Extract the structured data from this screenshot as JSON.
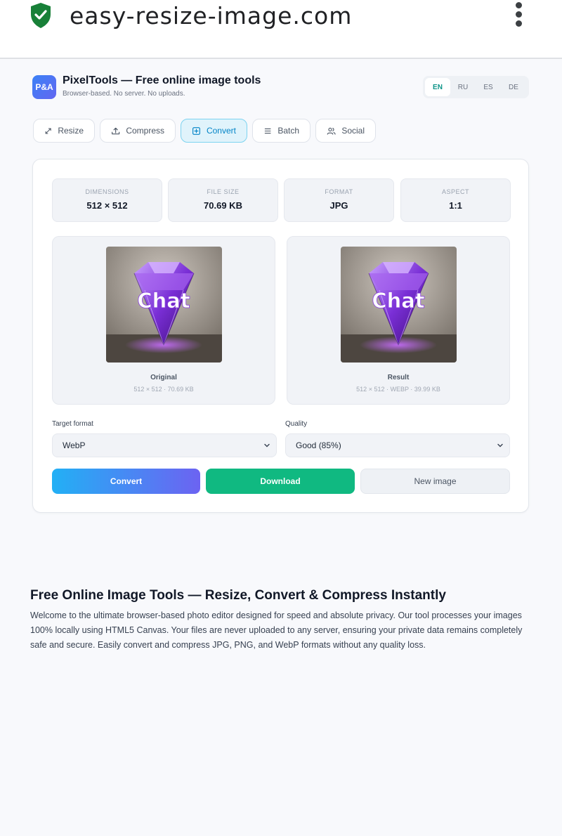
{
  "browser": {
    "url": "easy-resize-image.com",
    "secure_icon": "shield-check-icon",
    "menu_icon": "more-vert-icon"
  },
  "header": {
    "logo_text": "P&A",
    "title": "PixelTools — Free online image tools",
    "subtitle": "Browser-based. No server. No uploads.",
    "languages": [
      "EN",
      "RU",
      "ES",
      "DE"
    ],
    "active_language": "EN"
  },
  "tabs": [
    {
      "label": "Resize",
      "icon": "resize-icon"
    },
    {
      "label": "Compress",
      "icon": "upload-icon"
    },
    {
      "label": "Convert",
      "icon": "convert-icon",
      "active": true
    },
    {
      "label": "Batch",
      "icon": "list-icon"
    },
    {
      "label": "Social",
      "icon": "users-icon"
    }
  ],
  "stats": [
    {
      "label": "DIMENSIONS",
      "value": "512 × 512"
    },
    {
      "label": "FILE SIZE",
      "value": "70.69 KB"
    },
    {
      "label": "FORMAT",
      "value": "JPG"
    },
    {
      "label": "ASPECT",
      "value": "1:1"
    }
  ],
  "previews": {
    "original": {
      "label": "Original",
      "meta": "512 × 512 · 70.69 KB",
      "image_text": "Chat"
    },
    "result": {
      "label": "Result",
      "meta": "512 × 512 · WEBP · 39.99 KB",
      "image_text": "Chat"
    }
  },
  "controls": {
    "format_label": "Target format",
    "format_value": "WebP",
    "quality_label": "Quality",
    "quality_value": "Good (85%)"
  },
  "buttons": {
    "convert": "Convert",
    "download": "Download",
    "new_image": "New image"
  },
  "seo": {
    "title": "Free Online Image Tools — Resize, Convert & Compress Instantly",
    "body": "Welcome to the ultimate browser-based photo editor designed for speed and absolute privacy. Our tool processes your images 100% locally using HTML5 Canvas. Your files are never uploaded to any server, ensuring your private data remains completely safe and secure. Easily convert and compress JPG, PNG, and WebP formats without any quality loss."
  },
  "colors": {
    "accent": "#0284c7",
    "download": "#10b981",
    "secure": "#188038"
  }
}
